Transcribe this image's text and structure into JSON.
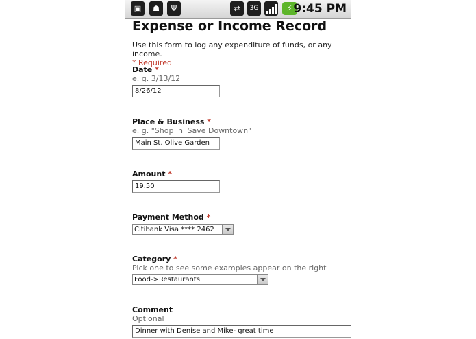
{
  "status_bar": {
    "time": "9:45 PM",
    "icons": [
      "clipboard-icon",
      "android-icon",
      "usb-icon",
      "sync-icon",
      "3g-icon",
      "signal-icon",
      "battery-charging-icon"
    ]
  },
  "form": {
    "title": "Expense or Income Record",
    "description": "Use this form to log any expenditure of funds, or any income.",
    "required_note": "* Required",
    "date": {
      "label": "Date",
      "required": "*",
      "hint": "e. g. 3/13/12",
      "value": "8/26/12"
    },
    "place": {
      "label": "Place & Business",
      "required": "*",
      "hint": "e. g. \"Shop 'n' Save Downtown\"",
      "value": "Main St. Olive Garden"
    },
    "amount": {
      "label": "Amount",
      "required": "*",
      "value": "19.50"
    },
    "payment": {
      "label": "Payment Method",
      "required": "*",
      "value": "Citibank Visa **** 2462"
    },
    "category": {
      "label": "Category",
      "required": "*",
      "hint": "Pick one to see some examples appear on the right",
      "value": "Food->Restaurants"
    },
    "comment": {
      "label": "Comment",
      "hint": "Optional",
      "value": "Dinner with Denise and Mike- great time!"
    }
  }
}
